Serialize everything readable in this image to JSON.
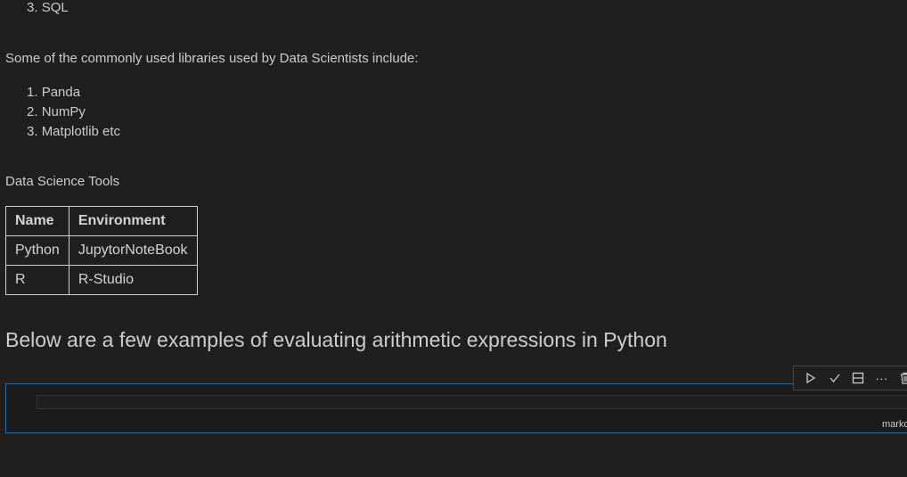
{
  "languages_list_tail": {
    "number": "3.",
    "label": "SQL"
  },
  "libraries_intro": "Some of the commonly used libraries used by Data Scientists include:",
  "libraries": [
    {
      "number": "1.",
      "label": "Panda"
    },
    {
      "number": "2.",
      "label": "NumPy"
    },
    {
      "number": "3.",
      "label": "Matplotlib etc"
    }
  ],
  "tools_caption": "Data Science Tools",
  "table": {
    "headers": [
      "Name",
      "Environment"
    ],
    "rows": [
      [
        "Python",
        "JupytorNoteBook"
      ],
      [
        "R",
        "R-Studio"
      ]
    ]
  },
  "heading": "Below are a few examples of evaluating arithmetic expressions in Python",
  "cell": {
    "language": "markdown"
  },
  "cell_toolbar": [
    "run-icon",
    "check-icon",
    "split-icon",
    "more-icon",
    "delete-icon"
  ],
  "colors": {
    "background": "#1f1f1f",
    "focus_border": "#0078d4",
    "text": "#cccccc"
  }
}
